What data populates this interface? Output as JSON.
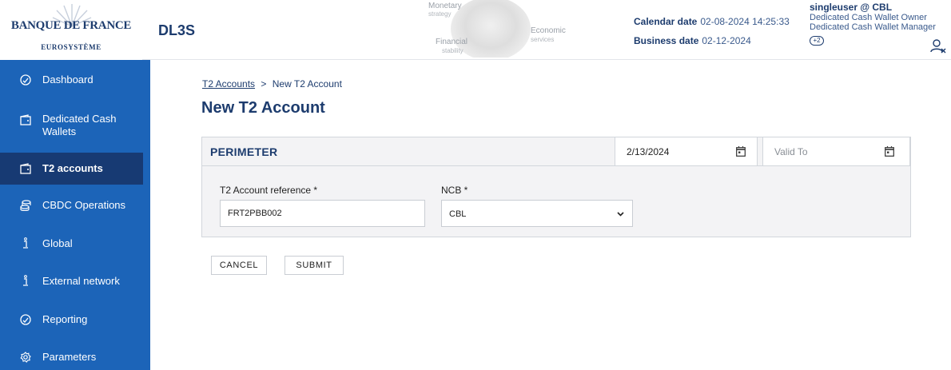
{
  "header": {
    "logo_title": "BANQUE DE FRANCE",
    "logo_subtitle": "EUROSYSTÈME",
    "app_name": "DL3S",
    "medallion": {
      "monetary": "Monetary",
      "strategy": "strategy",
      "economic": "Economic",
      "services": "services",
      "financial": "Financial",
      "stability": "stability"
    },
    "calendar_date_label": "Calendar date",
    "calendar_date_value": "02-08-2024 14:25:33",
    "business_date_label": "Business date",
    "business_date_value": "02-12-2024",
    "user": {
      "name": "singleuser @ CBL",
      "roles": [
        "Dedicated Cash Wallet Owner",
        "Dedicated Cash Wallet Manager"
      ],
      "more_badge": "+2"
    }
  },
  "sidebar": {
    "items": [
      {
        "label": "Dashboard",
        "icon": "clock-icon",
        "active": false
      },
      {
        "label": "Dedicated Cash Wallets",
        "icon": "wallet-icon",
        "active": false
      },
      {
        "label": "T2 accounts",
        "icon": "wallet-icon",
        "active": true
      },
      {
        "label": "CBDC Operations",
        "icon": "coins-icon",
        "active": false
      },
      {
        "label": "Global",
        "icon": "info-icon",
        "active": false
      },
      {
        "label": "External network",
        "icon": "info-icon",
        "active": false
      },
      {
        "label": "Reporting",
        "icon": "clock-icon",
        "active": false
      },
      {
        "label": "Parameters",
        "icon": "gear-icon",
        "active": false
      }
    ]
  },
  "breadcrumb": {
    "parent": "T2 Accounts",
    "separator": ">",
    "current": "New T2 Account"
  },
  "page_title": "New T2 Account",
  "perimeter": {
    "title": "PERIMETER",
    "valid_from": "2/13/2024",
    "valid_to_placeholder": "Valid To"
  },
  "form": {
    "reference_label": "T2 Account reference *",
    "reference_value": "FRT2PBB002",
    "ncb_label": "NCB *",
    "ncb_value": "CBL"
  },
  "actions": {
    "cancel": "CANCEL",
    "submit": "SUBMIT"
  },
  "colors": {
    "sidebar_bg": "#1c64b8",
    "sidebar_active": "#173a73",
    "brand_navy": "#1d3c6e"
  }
}
